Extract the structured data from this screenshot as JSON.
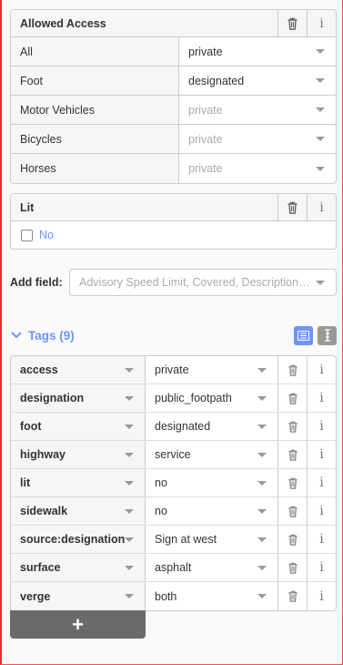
{
  "allowed_access": {
    "title": "Allowed Access",
    "rows": [
      {
        "label": "All",
        "value": "private",
        "placeholder": false
      },
      {
        "label": "Foot",
        "value": "designated",
        "placeholder": false
      },
      {
        "label": "Motor Vehicles",
        "value": "private",
        "placeholder": true
      },
      {
        "label": "Bicycles",
        "value": "private",
        "placeholder": true
      },
      {
        "label": "Horses",
        "value": "private",
        "placeholder": true
      }
    ]
  },
  "lit": {
    "title": "Lit",
    "check_label": "No"
  },
  "add_field": {
    "label": "Add field:",
    "placeholder": "Advisory Speed Limit, Covered, Description…"
  },
  "tags": {
    "header": "Tags (9)",
    "rows": [
      {
        "key": "access",
        "value": "private"
      },
      {
        "key": "designation",
        "value": "public_footpath"
      },
      {
        "key": "foot",
        "value": "designated"
      },
      {
        "key": "highway",
        "value": "service"
      },
      {
        "key": "lit",
        "value": "no"
      },
      {
        "key": "sidewalk",
        "value": "no"
      },
      {
        "key": "source:designation",
        "value": "Sign at west"
      },
      {
        "key": "surface",
        "value": "asphalt"
      },
      {
        "key": "verge",
        "value": "both"
      }
    ],
    "add_label": "+"
  },
  "colors": {
    "accent": "#7092ff",
    "border": "#cccccc",
    "header_bg": "#f6f6f6",
    "add_button": "#6a6a6a"
  },
  "icons": {
    "delete": "trash-icon",
    "info": "info-icon",
    "caret": "chevron-down-icon",
    "text_view": "text-view-icon",
    "list_view": "list-view-icon"
  }
}
